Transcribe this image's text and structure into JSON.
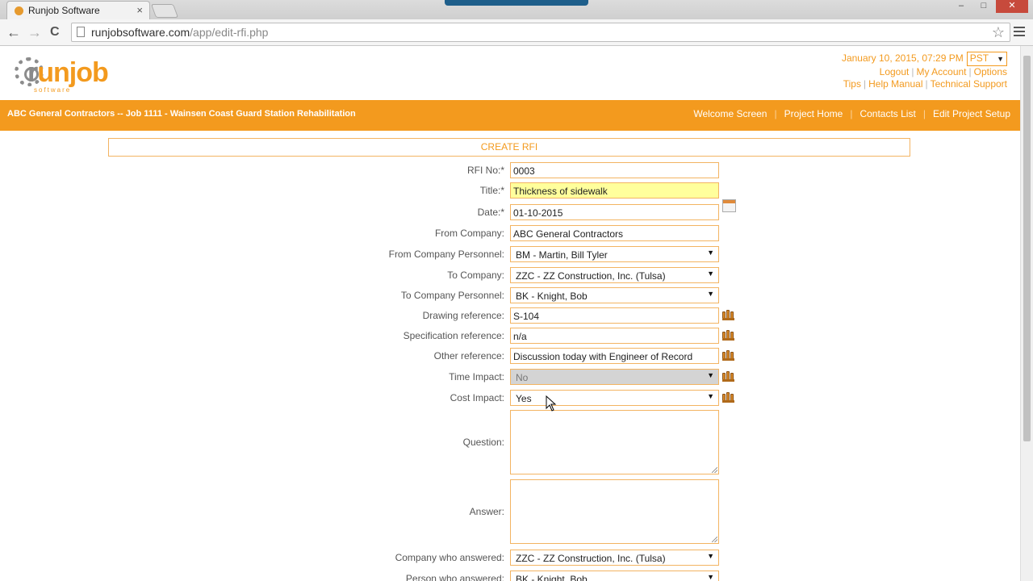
{
  "browser": {
    "tab_title": "Runjob Software",
    "tab_close": "×",
    "url_domain": "runjobsoftware.com",
    "url_path": "/app/edit-rfi.php",
    "back_icon": "←",
    "forward_icon": "→",
    "reload_icon": "C",
    "star_icon": "☆",
    "min_icon": "–",
    "max_icon": "□",
    "close_icon": "✕"
  },
  "logo": {
    "r": "r",
    "rest": "unjob",
    "sub": "software"
  },
  "header": {
    "datetime": "January 10, 2015, 07:29 PM",
    "timezone": "PST",
    "links_row1": [
      "Logout",
      "My Account",
      "Options"
    ],
    "links_row2": [
      "Tips",
      "Help Manual",
      "Technical Support"
    ]
  },
  "nav": {
    "job_title": "ABC General Contractors -- Job 1111 - Wainsen Coast Guard Station Rehabilitation",
    "links": [
      "Welcome Screen",
      "Project Home",
      "Contacts List",
      "Edit Project Setup"
    ]
  },
  "form": {
    "heading": "CREATE RFI",
    "rfi_no": {
      "label": "RFI No:",
      "req": "*",
      "value": "0003"
    },
    "title": {
      "label": "Title:",
      "req": "*",
      "value": "Thickness of sidewalk"
    },
    "date": {
      "label": "Date:",
      "req": "*",
      "value": "01-10-2015"
    },
    "from_company": {
      "label": "From Company:",
      "value": "ABC General Contractors"
    },
    "from_personnel": {
      "label": "From Company Personnel:",
      "value": "BM - Martin, Bill Tyler"
    },
    "to_company": {
      "label": "To Company:",
      "value": "ZZC - ZZ Construction, Inc. (Tulsa)"
    },
    "to_personnel": {
      "label": "To Company Personnel:",
      "value": "BK - Knight, Bob"
    },
    "drawing_ref": {
      "label": "Drawing reference:",
      "value": "S-104"
    },
    "spec_ref": {
      "label": "Specification reference:",
      "value": "n/a"
    },
    "other_ref": {
      "label": "Other reference:",
      "value": "Discussion today with Engineer of Record"
    },
    "time_impact": {
      "label": "Time Impact:",
      "value": "No"
    },
    "cost_impact": {
      "label": "Cost Impact:",
      "value": "Yes"
    },
    "question": {
      "label": "Question:",
      "value": ""
    },
    "answer": {
      "label": "Answer:",
      "value": ""
    },
    "company_answered": {
      "label": "Company who answered:",
      "value": "ZZC - ZZ Construction, Inc. (Tulsa)"
    },
    "person_answered": {
      "label": "Person who answered:",
      "value": "BK - Knight, Bob"
    }
  },
  "select_arrow": "▼"
}
